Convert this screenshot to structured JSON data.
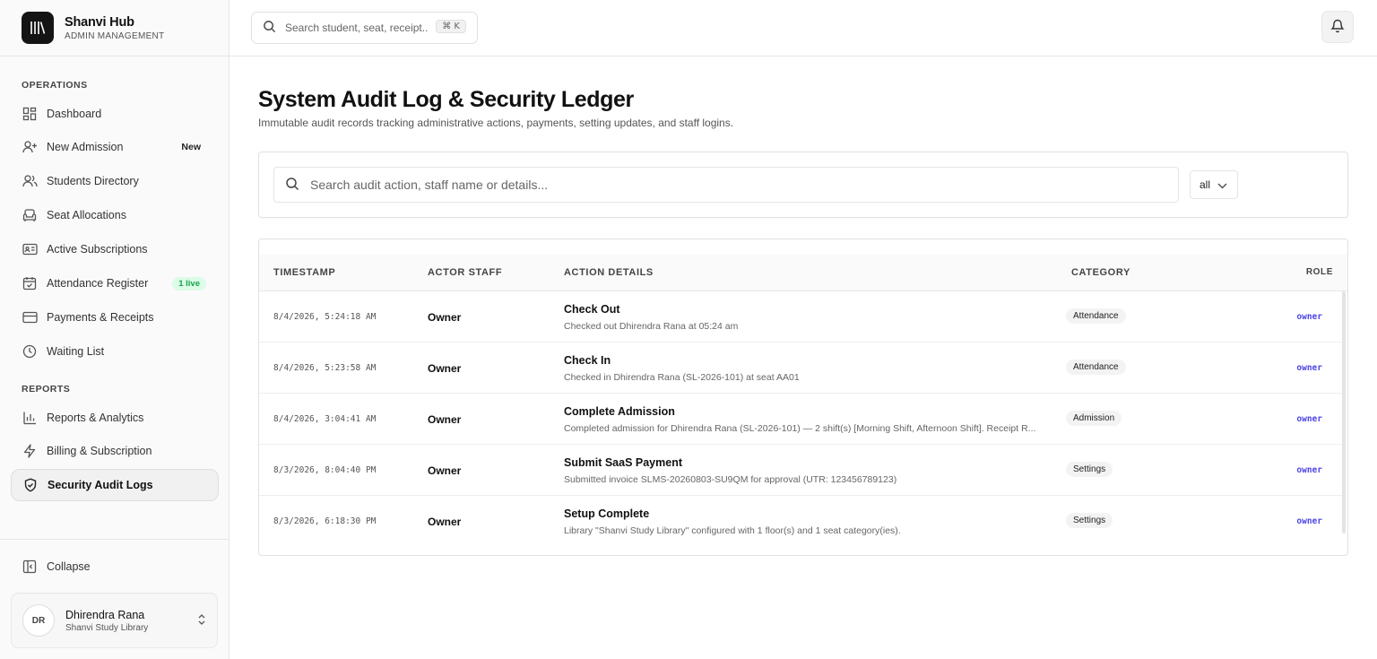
{
  "brand": {
    "name": "Shanvi Hub",
    "subtitle": "ADMIN MANAGEMENT"
  },
  "topbar": {
    "search_placeholder": "Search student, seat, receipt...",
    "shortcut": "⌘ K"
  },
  "sidebar": {
    "operations_label": "OPERATIONS",
    "reports_label": "REPORTS",
    "items": [
      {
        "label": "Dashboard",
        "icon": "dashboard-icon"
      },
      {
        "label": "New Admission",
        "icon": "user-plus-icon",
        "badge": "New"
      },
      {
        "label": "Students Directory",
        "icon": "users-icon"
      },
      {
        "label": "Seat Allocations",
        "icon": "armchair-icon"
      },
      {
        "label": "Active Subscriptions",
        "icon": "id-card-icon"
      },
      {
        "label": "Attendance Register",
        "icon": "calendar-check-icon",
        "badge": "1 live"
      },
      {
        "label": "Payments & Receipts",
        "icon": "credit-card-icon"
      },
      {
        "label": "Waiting List",
        "icon": "clock-icon"
      },
      {
        "label": "Reports & Analytics",
        "icon": "bar-chart-icon"
      },
      {
        "label": "Billing & Subscription",
        "icon": "zap-icon"
      },
      {
        "label": "Security Audit Logs",
        "icon": "shield-check-icon",
        "active": true
      }
    ],
    "collapse_label": "Collapse",
    "user": {
      "initials": "DR",
      "name": "Dhirendra Rana",
      "library": "Shanvi Study Library"
    }
  },
  "main": {
    "title": "System Audit Log & Security Ledger",
    "subtitle": "Immutable audit records tracking administrative actions, payments, setting updates, and staff logins.",
    "filter": {
      "search_placeholder": "Search audit action, staff name or details...",
      "category_value": "all"
    },
    "table": {
      "headers": [
        "TIMESTAMP",
        "ACTOR STAFF",
        "ACTION DETAILS",
        "CATEGORY",
        "ROLE"
      ],
      "rows": [
        {
          "timestamp": "8/4/2026, 5:24:18 AM",
          "actor": "Owner",
          "action": "Check Out",
          "detail": "Checked out Dhirendra Rana at 05:24 am",
          "category": "Attendance",
          "role": "owner"
        },
        {
          "timestamp": "8/4/2026, 5:23:58 AM",
          "actor": "Owner",
          "action": "Check In",
          "detail": "Checked in Dhirendra Rana (SL-2026-101) at seat AA01",
          "category": "Attendance",
          "role": "owner"
        },
        {
          "timestamp": "8/4/2026, 3:04:41 AM",
          "actor": "Owner",
          "action": "Complete Admission",
          "detail": "Completed admission for Dhirendra Rana (SL-2026-101) — 2 shift(s) [Morning Shift, Afternoon Shift]. Receipt R...",
          "category": "Admission",
          "role": "owner"
        },
        {
          "timestamp": "8/3/2026, 8:04:40 PM",
          "actor": "Owner",
          "action": "Submit SaaS Payment",
          "detail": "Submitted invoice SLMS-20260803-SU9QM for approval (UTR: 123456789123)",
          "category": "Settings",
          "role": "owner"
        },
        {
          "timestamp": "8/3/2026, 6:18:30 PM",
          "actor": "Owner",
          "action": "Setup Complete",
          "detail": "Library \"Shanvi Study Library\" configured with 1 floor(s) and 1 seat category(ies).",
          "category": "Settings",
          "role": "owner"
        }
      ]
    }
  },
  "colors": {
    "accent_role": "#4f46e5",
    "live_badge": "#16a34a",
    "brand_dark": "#141414"
  }
}
